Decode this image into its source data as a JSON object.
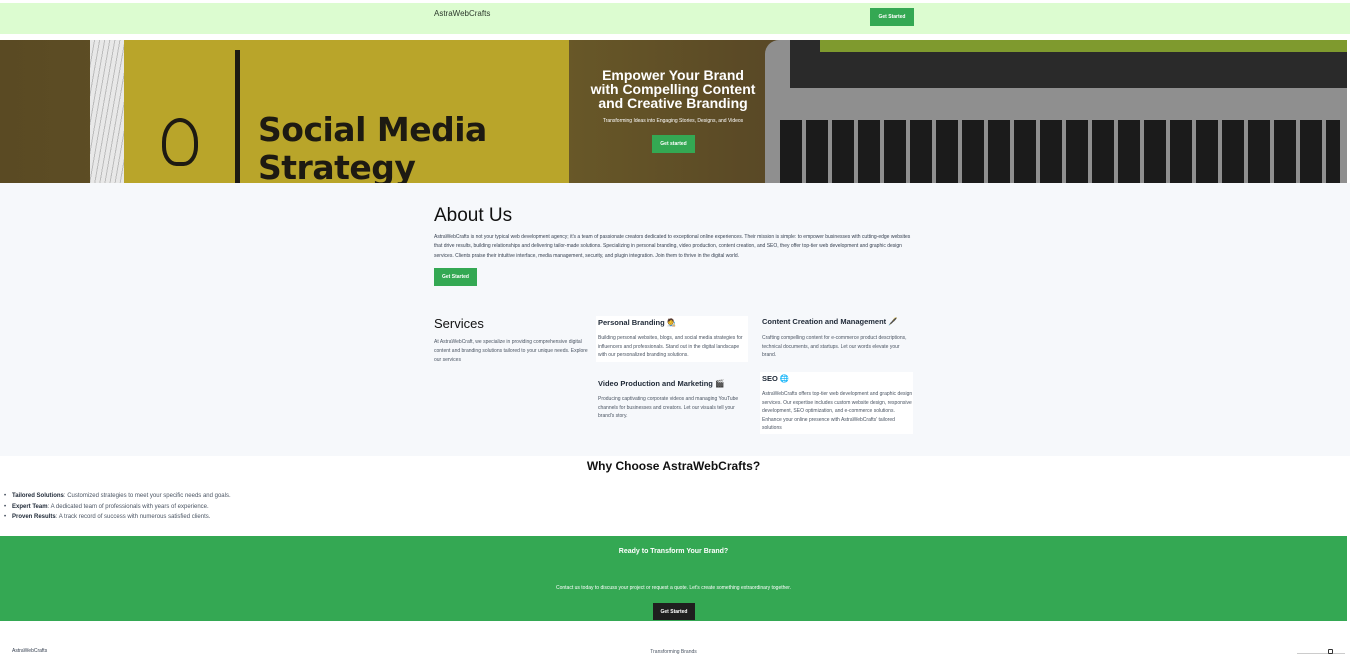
{
  "header": {
    "brand": "AstraWebCrafts",
    "cta_label": "Get Started"
  },
  "hero": {
    "title_line1": "Empower Your Brand",
    "title_line2": "with Compelling Content",
    "title_line3": "and Creative Branding",
    "subtitle": "Transforming Ideas into Engaging Stories, Designs, and Videos",
    "cta_label": "Get started",
    "image_text_line1": "Social Media",
    "image_text_line2": "Strategy"
  },
  "about": {
    "title": "About Us",
    "text": "AstraWebCrafts is not your typical web development agency; it's a team of passionate creators dedicated to exceptional online experiences. Their mission is simple: to empower businesses with cutting-edge websites that drive results, building relationships and delivering tailor-made solutions. Specializing in personal branding, video production, content creation, and SEO, they offer top-tier web development and graphic design services. Clients praise their intuitive interface, media management, security, and plugin integration. Join them to thrive in the digital world.",
    "cta_label": "Get Started"
  },
  "services": {
    "title": "Services",
    "intro": "At AstraWebCraft, we specialize in providing comprehensive digital content and branding solutions tailored to your unique needs. Explore our services",
    "items": [
      {
        "title": "Personal Branding 🧑‍🎨",
        "text": "Building personal websites, blogs, and social media strategies for influencers and professionals. Stand out in the digital landscape with our personalized branding solutions."
      },
      {
        "title": "Content Creation and Management 🖋️",
        "text": "Crafting compelling content for e-commerce product descriptions, technical documents, and startups. Let our words elevate your brand."
      },
      {
        "title": "Video Production and Marketing 🎬",
        "text": "Producing captivating corporate videos and managing YouTube channels for businesses and creators. Let our visuals tell your brand's story."
      },
      {
        "title": "SEO 🌐",
        "text": "AstraWebCrafts offers top-tier web development and graphic design services. Our expertise includes custom website design, responsive development, SEO optimization, and e-commerce solutions. Enhance your online presence with AstraWebCrafts' tailored solutions"
      }
    ]
  },
  "why": {
    "title": "Why Choose AstraWebCrafts?",
    "items": [
      {
        "label": "Tailored Solutions",
        "text": ": Customized strategies to meet your specific needs and goals."
      },
      {
        "label": "Expert Team",
        "text": ": A dedicated team of professionals with years of experience."
      },
      {
        "label": "Proven Results",
        "text": ": A track record of success with numerous satisfied clients."
      }
    ]
  },
  "cta": {
    "title": "Ready to Transform Your Brand?",
    "text": "Contact us today to discuss your project or request a quote. Let's create something extraordinary together.",
    "button_label": "Get Started"
  },
  "footer": {
    "brand": "AstraWebCrafts",
    "tagline": "Transforming Brands",
    "icon": "instagram-icon"
  },
  "colors": {
    "accent": "#34a853",
    "header_bg": "#dcfcd0",
    "section_bg": "#f6f8fb",
    "dark_button": "#1f1f1f"
  }
}
